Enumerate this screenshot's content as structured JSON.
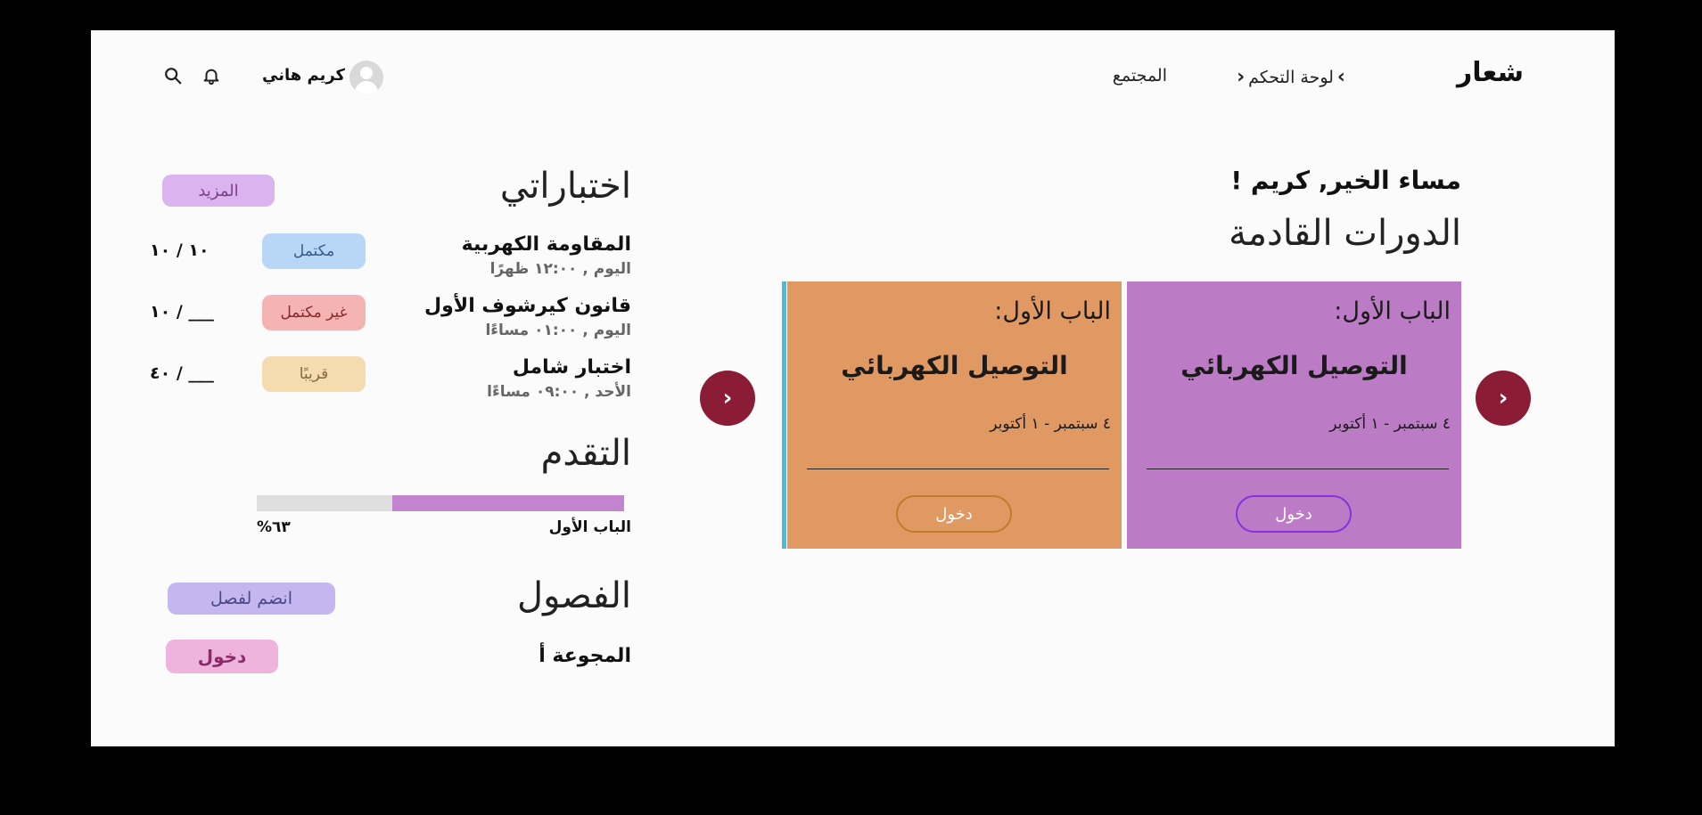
{
  "header": {
    "logo": "شعار",
    "nav": {
      "dashboard": "لوحة التحكم",
      "community": "المجتمع"
    },
    "user_name": "كريم هاني"
  },
  "greeting": "مساء الخير, كريم !",
  "upcoming": {
    "title": "الدورات القادمة",
    "cards": [
      {
        "chapter": "الباب الأول:",
        "course": "التوصيل الكهربائي",
        "dates": "٤ سبتمبر - ١ أكتوبر",
        "enter_label": "دخول",
        "color": "#bc7cc5"
      },
      {
        "chapter": "الباب الأول:",
        "course": "التوصيل الكهربائي",
        "dates": "٤ سبتمبر - ١ أكتوبر",
        "enter_label": "دخول",
        "color": "#e09962"
      }
    ],
    "next_icon": "chevron-right-icon",
    "prev_icon": "chevron-right-icon"
  },
  "tests": {
    "title": "اختباراتي",
    "more_label": "المزيد",
    "items": [
      {
        "name": "المقاومة الكهربية",
        "time": "اليوم , ١٢:٠٠ ظهرًا",
        "status": "مكتمل",
        "status_color": "#b8d6f5",
        "status_text_color": "#3a5a8a",
        "score": "١٠ / ١٠"
      },
      {
        "name": "قانون كيرشوف الأول",
        "time": "اليوم , ٠١:٠٠ مساءًا",
        "status": "غير مكتمل",
        "status_color": "#f5b4b4",
        "status_text_color": "#8a2a2a",
        "score": "١٠ / ___"
      },
      {
        "name": "اختبار شامل",
        "time": "الأحد , ٠٩:٠٠ مساءًا",
        "status": "قريبًا",
        "status_color": "#f5dbb0",
        "status_text_color": "#8a6a3a",
        "score": "٤٠ / ___"
      }
    ]
  },
  "progress": {
    "title": "التقدم",
    "label": "الباب الأول",
    "percent_text": "%٦٣",
    "value": 0.63
  },
  "classes": {
    "title": "الفصول",
    "join_label": "انضم لفصل",
    "groups": [
      {
        "name": "المجوعة أ",
        "enter_label": "دخول"
      }
    ]
  }
}
